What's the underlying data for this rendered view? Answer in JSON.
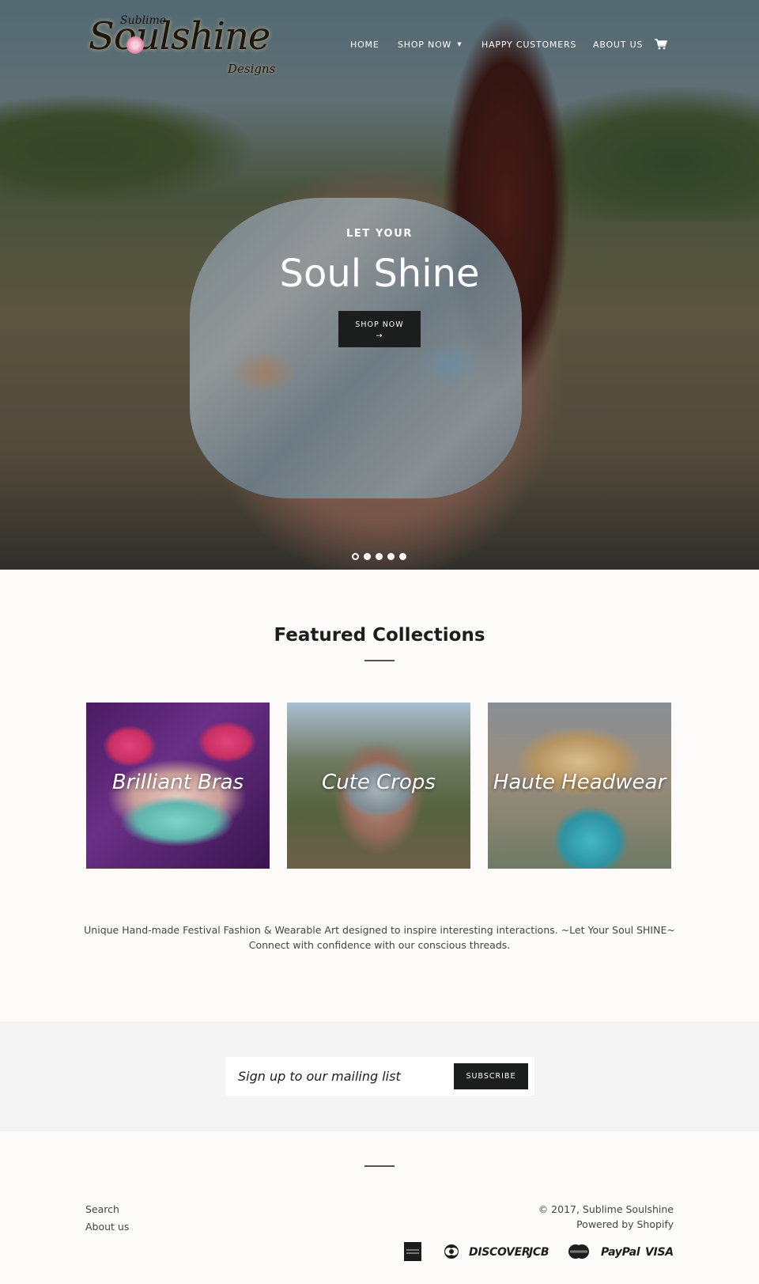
{
  "logo": {
    "small_text": "Sublime",
    "main_text": "Soulshine",
    "sub_text": "Designs"
  },
  "nav": {
    "items": [
      {
        "label": "HOME"
      },
      {
        "label": "SHOP NOW",
        "has_dropdown": true
      },
      {
        "label": "HAPPY CUSTOMERS"
      },
      {
        "label": "ABOUT US"
      }
    ],
    "cart_icon": "cart-icon"
  },
  "hero": {
    "eyebrow": "LET YOUR",
    "headline": "Soul Shine",
    "button_label": "SHOP NOW",
    "button_arrow": "→",
    "slides": {
      "count": 5,
      "active_index": 0
    }
  },
  "featured": {
    "title": "Featured Collections",
    "collections": [
      {
        "label": "Brilliant Bras"
      },
      {
        "label": "Cute Crops"
      },
      {
        "label": "Haute Headwear"
      }
    ]
  },
  "blurb": {
    "line1": "Unique Hand-made Festival Fashion & Wearable Art designed to inspire interesting interactions. ~Let Your Soul SHINE~",
    "line2": "Connect with confidence with our conscious threads."
  },
  "newsletter": {
    "placeholder": "Sign up to our mailing list",
    "button_label": "SUBSCRIBE"
  },
  "footer": {
    "links": [
      {
        "label": "Search"
      },
      {
        "label": "About us"
      }
    ],
    "copyright": "© 2017, Sublime Soulshine",
    "powered_by": "Powered by Shopify",
    "payment_methods": [
      "american_express",
      "diners_club",
      "DISCOVER",
      "JCB",
      "MasterCard",
      "PayPal",
      "VISA"
    ]
  },
  "colors": {
    "accent_dark": "#1c1d1d",
    "background": "#fcfbf9",
    "newsletter_bg": "#f4f4f4"
  }
}
